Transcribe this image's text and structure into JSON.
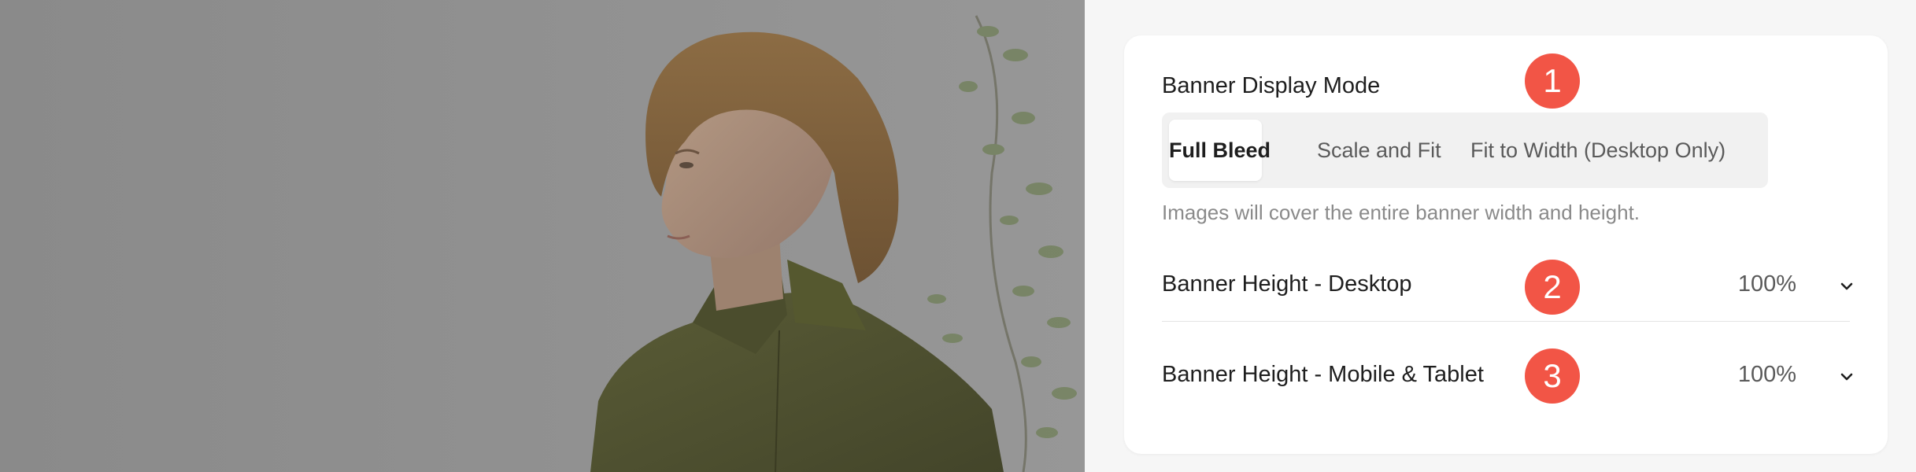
{
  "photo": {
    "description_icon": "portrait-photo"
  },
  "settings": {
    "display_mode": {
      "label": "Banner Display Mode",
      "options": [
        "Full Bleed",
        "Scale and Fit",
        "Fit to Width (Desktop Only)"
      ],
      "selected": "Full Bleed",
      "hint": "Images will cover the entire banner width and height."
    },
    "height_desktop": {
      "label": "Banner Height - Desktop",
      "value": "100%"
    },
    "height_mobile": {
      "label": "Banner Height - Mobile & Tablet",
      "value": "100%"
    }
  },
  "callouts": [
    "1",
    "2",
    "3"
  ],
  "colors": {
    "callout": "#f25546",
    "card": "#ffffff",
    "background": "#f6f6f6"
  }
}
